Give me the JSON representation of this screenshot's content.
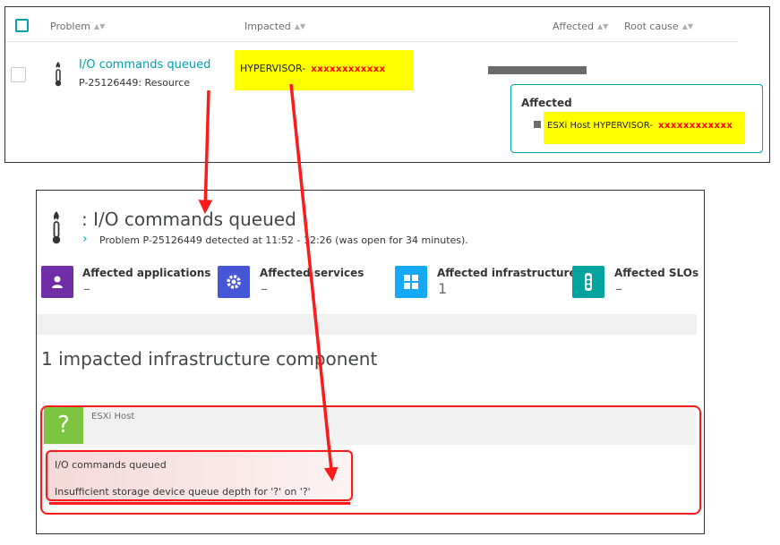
{
  "problems_table": {
    "headers": {
      "problem": "Problem",
      "impacted": "Impacted",
      "affected": "Affected",
      "root_cause": "Root cause"
    },
    "row": {
      "title": "I/O commands queued",
      "id_line": "P-25126449: Resource",
      "impacted_prefix": "HYPERVISOR-",
      "impacted_redacted": "xxxxxxxxxxxx"
    },
    "tooltip": {
      "title": "Affected",
      "item_prefix": "ESXi Host HYPERVISOR-",
      "item_redacted": "xxxxxxxxxxxx"
    }
  },
  "problem_detail": {
    "title": ": I/O commands queued",
    "subtitle": "Problem P-25126449 detected at 11:52 - 12:26 (was open for 34 minutes).",
    "tiles": [
      {
        "label": "Affected applications",
        "value": "–",
        "color": "#6f2da8",
        "icon": "user-icon"
      },
      {
        "label": "Affected services",
        "value": "–",
        "color": "#4556d7",
        "icon": "gear-icon"
      },
      {
        "label": "Affected infrastructure",
        "value": "1",
        "color": "#14a8f5",
        "icon": "infrastructure-icon"
      },
      {
        "label": "Affected SLOs",
        "value": "–",
        "color": "#00a39d",
        "icon": "traffic-light-icon"
      }
    ],
    "section_title": "1 impacted infrastructure component",
    "component": {
      "icon_glyph": "?",
      "type": "ESXi Host",
      "event_title": "I/O commands queued",
      "event_description": "Insufficient storage device queue depth for '?' on '?'"
    }
  },
  "colors": {
    "accent": "#00a1b2",
    "highlight": "#ffff00",
    "annotation_red": "#ff1a1a",
    "component_green": "#7dc540"
  }
}
